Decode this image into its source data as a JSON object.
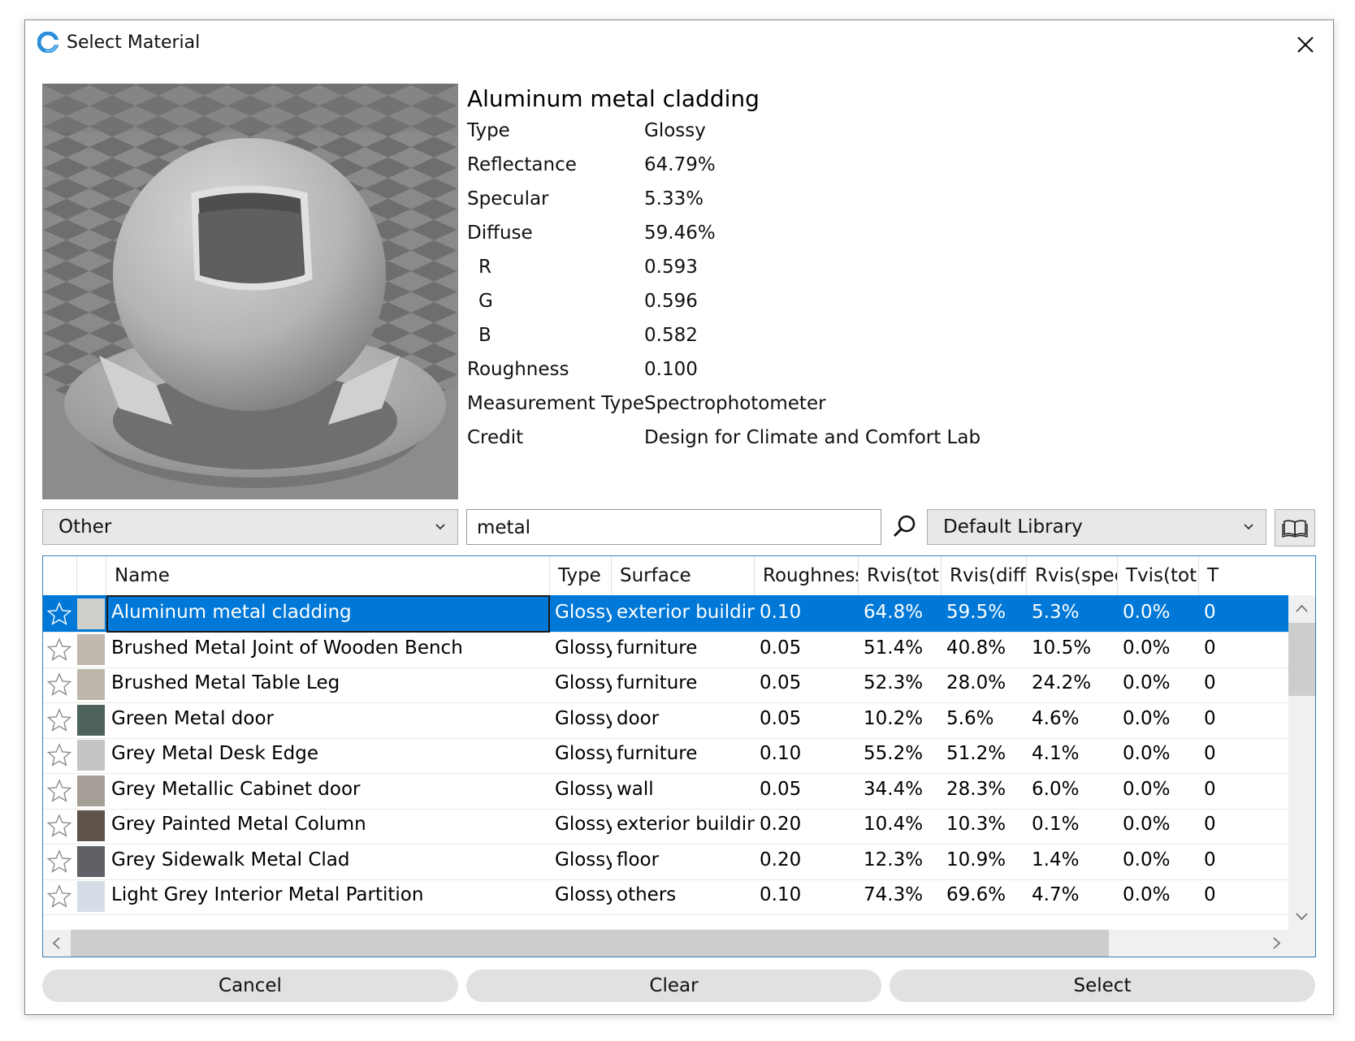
{
  "window": {
    "title": "Select Material"
  },
  "details": {
    "name": "Aluminum metal cladding",
    "properties": [
      {
        "label": "Type",
        "value": "Glossy"
      },
      {
        "label": "Reflectance",
        "value": "64.79%"
      },
      {
        "label": "Specular",
        "value": "5.33%"
      },
      {
        "label": "Diffuse",
        "value": "59.46%"
      },
      {
        "label": "R",
        "value": "0.593"
      },
      {
        "label": "G",
        "value": "0.596"
      },
      {
        "label": "B",
        "value": "0.582"
      },
      {
        "label": "Roughness",
        "value": "0.100"
      },
      {
        "label": "Measurement Type",
        "value": "Spectrophotometer"
      },
      {
        "label": "Credit",
        "value": "Design for Climate and Comfort Lab"
      }
    ]
  },
  "controls": {
    "category": "Other",
    "search_value": "metal",
    "library": "Default Library"
  },
  "table": {
    "columns": [
      "Name",
      "Type",
      "Surface",
      "Roughness",
      "Rvis(tot)",
      "Rvis(diff)",
      "Rvis(spec)",
      "Tvis(tot)",
      "T"
    ],
    "rows": [
      {
        "swatch": "#cfcfcc",
        "name": "Aluminum metal cladding",
        "type": "Glossy",
        "surface": "exterior building",
        "roughness": "0.10",
        "rvis_tot": "64.8%",
        "rvis_diff": "59.5%",
        "rvis_spec": "5.3%",
        "tvis_tot": "0.0%",
        "more": "0"
      },
      {
        "swatch": "#c1b9ad",
        "name": "Brushed Metal Joint of Wooden Bench",
        "type": "Glossy",
        "surface": "furniture",
        "roughness": "0.05",
        "rvis_tot": "51.4%",
        "rvis_diff": "40.8%",
        "rvis_spec": "10.5%",
        "tvis_tot": "0.0%",
        "more": "0"
      },
      {
        "swatch": "#bfb7ab",
        "name": "Brushed Metal Table Leg",
        "type": "Glossy",
        "surface": "furniture",
        "roughness": "0.05",
        "rvis_tot": "52.3%",
        "rvis_diff": "28.0%",
        "rvis_spec": "24.2%",
        "tvis_tot": "0.0%",
        "more": "0"
      },
      {
        "swatch": "#4d625a",
        "name": "Green Metal door",
        "type": "Glossy",
        "surface": "door",
        "roughness": "0.05",
        "rvis_tot": "10.2%",
        "rvis_diff": "5.6%",
        "rvis_spec": "4.6%",
        "tvis_tot": "0.0%",
        "more": "0"
      },
      {
        "swatch": "#c4c6c3",
        "name": "Grey Metal Desk Edge",
        "type": "Glossy",
        "surface": "furniture",
        "roughness": "0.10",
        "rvis_tot": "55.2%",
        "rvis_diff": "51.2%",
        "rvis_spec": "4.1%",
        "tvis_tot": "0.0%",
        "more": "0"
      },
      {
        "swatch": "#a59f98",
        "name": "Grey Metallic Cabinet door",
        "type": "Glossy",
        "surface": "wall",
        "roughness": "0.05",
        "rvis_tot": "34.4%",
        "rvis_diff": "28.3%",
        "rvis_spec": "6.0%",
        "tvis_tot": "0.0%",
        "more": "0"
      },
      {
        "swatch": "#5e544c",
        "name": "Grey Painted Metal Column",
        "type": "Glossy",
        "surface": "exterior building",
        "roughness": "0.20",
        "rvis_tot": "10.4%",
        "rvis_diff": "10.3%",
        "rvis_spec": "0.1%",
        "tvis_tot": "0.0%",
        "more": "0"
      },
      {
        "swatch": "#5f6166",
        "name": "Grey Sidewalk Metal Clad",
        "type": "Glossy",
        "surface": "floor",
        "roughness": "0.20",
        "rvis_tot": "12.3%",
        "rvis_diff": "10.9%",
        "rvis_spec": "1.4%",
        "tvis_tot": "0.0%",
        "more": "0"
      },
      {
        "swatch": "#d7dde6",
        "name": "Light Grey Interior Metal Partition",
        "type": "Glossy",
        "surface": "others",
        "roughness": "0.10",
        "rvis_tot": "74.3%",
        "rvis_diff": "69.6%",
        "rvis_spec": "4.7%",
        "tvis_tot": "0.0%",
        "more": "0"
      }
    ]
  },
  "buttons": {
    "cancel": "Cancel",
    "clear": "Clear",
    "select": "Select"
  },
  "colors": {
    "selection": "#0078d7",
    "table_border": "#3c7fb1"
  }
}
